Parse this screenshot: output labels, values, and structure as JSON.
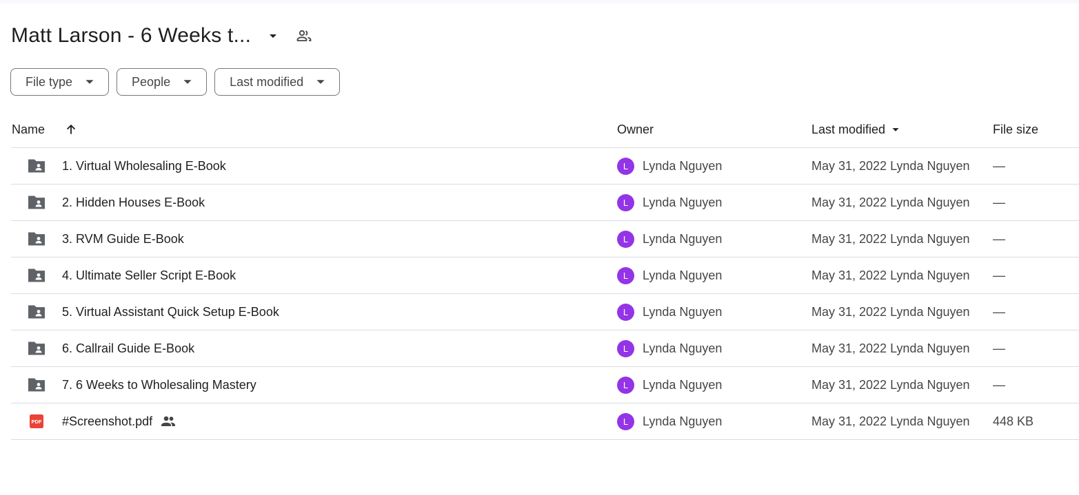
{
  "header": {
    "title": "Matt Larson - 6 Weeks t...",
    "title_caret_icon": "arrow-drop-down-icon",
    "share_icon": "shared-people-outline-icon"
  },
  "filters": [
    {
      "label": "File type"
    },
    {
      "label": "People"
    },
    {
      "label": "Last modified"
    }
  ],
  "columns": {
    "name": "Name",
    "owner": "Owner",
    "last_modified": "Last modified",
    "file_size": "File size",
    "sort_icon": "arrow-upward-icon",
    "modified_sort_icon": "arrow-drop-down-icon"
  },
  "colors": {
    "avatar": "#9334e6",
    "folder": "#5f6368",
    "pdf": "#ea4335",
    "border": "#dadce0"
  },
  "rows": [
    {
      "type": "shared-folder",
      "name": "1. Virtual Wholesaling E-Book",
      "owner_initial": "L",
      "owner": "Lynda Nguyen",
      "modified": "May 31, 2022 Lynda Nguyen",
      "size": "—"
    },
    {
      "type": "shared-folder",
      "name": "2. Hidden Houses E-Book",
      "owner_initial": "L",
      "owner": "Lynda Nguyen",
      "modified": "May 31, 2022 Lynda Nguyen",
      "size": "—"
    },
    {
      "type": "shared-folder",
      "name": "3. RVM Guide E-Book",
      "owner_initial": "L",
      "owner": "Lynda Nguyen",
      "modified": "May 31, 2022 Lynda Nguyen",
      "size": "—"
    },
    {
      "type": "shared-folder",
      "name": "4. Ultimate Seller Script E-Book",
      "owner_initial": "L",
      "owner": "Lynda Nguyen",
      "modified": "May 31, 2022 Lynda Nguyen",
      "size": "—"
    },
    {
      "type": "shared-folder",
      "name": "5. Virtual Assistant Quick Setup E-Book",
      "owner_initial": "L",
      "owner": "Lynda Nguyen",
      "modified": "May 31, 2022 Lynda Nguyen",
      "size": "—"
    },
    {
      "type": "shared-folder",
      "name": "6. Callrail Guide E-Book",
      "owner_initial": "L",
      "owner": "Lynda Nguyen",
      "modified": "May 31, 2022 Lynda Nguyen",
      "size": "—"
    },
    {
      "type": "shared-folder",
      "name": "7. 6 Weeks to Wholesaling Mastery",
      "owner_initial": "L",
      "owner": "Lynda Nguyen",
      "modified": "May 31, 2022 Lynda Nguyen",
      "size": "—"
    },
    {
      "type": "pdf",
      "pdf_badge": "PDF",
      "name": "#Screenshot.pdf",
      "shared": true,
      "owner_initial": "L",
      "owner": "Lynda Nguyen",
      "modified": "May 31, 2022 Lynda Nguyen",
      "size": "448 KB"
    }
  ]
}
